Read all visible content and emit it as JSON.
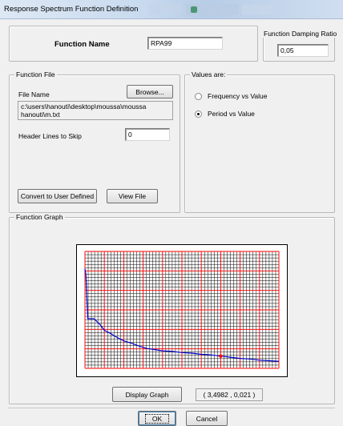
{
  "window": {
    "title": "Response Spectrum  Function Definition"
  },
  "function_name": {
    "label": "Function Name",
    "value": "RPA99"
  },
  "damping": {
    "legend": "Function Damping Ratio",
    "value": "0,05"
  },
  "function_file": {
    "legend": "Function File",
    "file_name_label": "File Name",
    "browse_label": "Browse...",
    "file_path_line1": "c:\\users\\hanouti\\desktop\\moussa\\moussa",
    "file_path_line2": "hanouti\\m.txt",
    "header_lines_label": "Header Lines to Skip",
    "header_lines_value": "0",
    "convert_label": "Convert to User Defined",
    "view_file_label": "View File"
  },
  "values_are": {
    "legend": "Values are:",
    "options": [
      {
        "label": "Frequency vs Value",
        "selected": false
      },
      {
        "label": "Period vs Value",
        "selected": true
      }
    ]
  },
  "function_graph": {
    "legend": "Function Graph",
    "display_graph_label": "Display Graph",
    "coord_readout": "( 3,4982 ,  0,021 )",
    "grid_color": "#ff0000",
    "curve_color": "#0000cc",
    "marker_color": "#ff0000"
  },
  "chart_data": {
    "type": "line",
    "title": "",
    "xlabel": "",
    "ylabel": "",
    "xlim": [
      0,
      10
    ],
    "ylim": [
      0,
      0.2
    ],
    "grid": true,
    "series": [
      {
        "x": [
          0,
          0.05,
          0.1,
          0.15,
          0.3,
          0.45,
          0.5,
          0.8,
          1.0,
          1.3,
          1.6,
          2.0,
          2.4,
          2.8,
          3.2,
          3.6,
          4.0,
          4.5,
          5.0,
          5.5,
          6.0,
          6.5,
          7.0,
          7.5,
          8.0,
          8.5,
          9.0,
          9.5,
          10.0
        ],
        "y": [
          0.17,
          0.16,
          0.12,
          0.085,
          0.085,
          0.085,
          0.084,
          0.074,
          0.065,
          0.06,
          0.054,
          0.047,
          0.043,
          0.038,
          0.034,
          0.032,
          0.03,
          0.029,
          0.027,
          0.026,
          0.024,
          0.023,
          0.021,
          0.019,
          0.017,
          0.016,
          0.014,
          0.013,
          0.012
        ]
      }
    ],
    "marker": {
      "x": 7.0,
      "y": 0.021
    }
  },
  "footer": {
    "ok_label": "OK",
    "cancel_label": "Cancel"
  }
}
